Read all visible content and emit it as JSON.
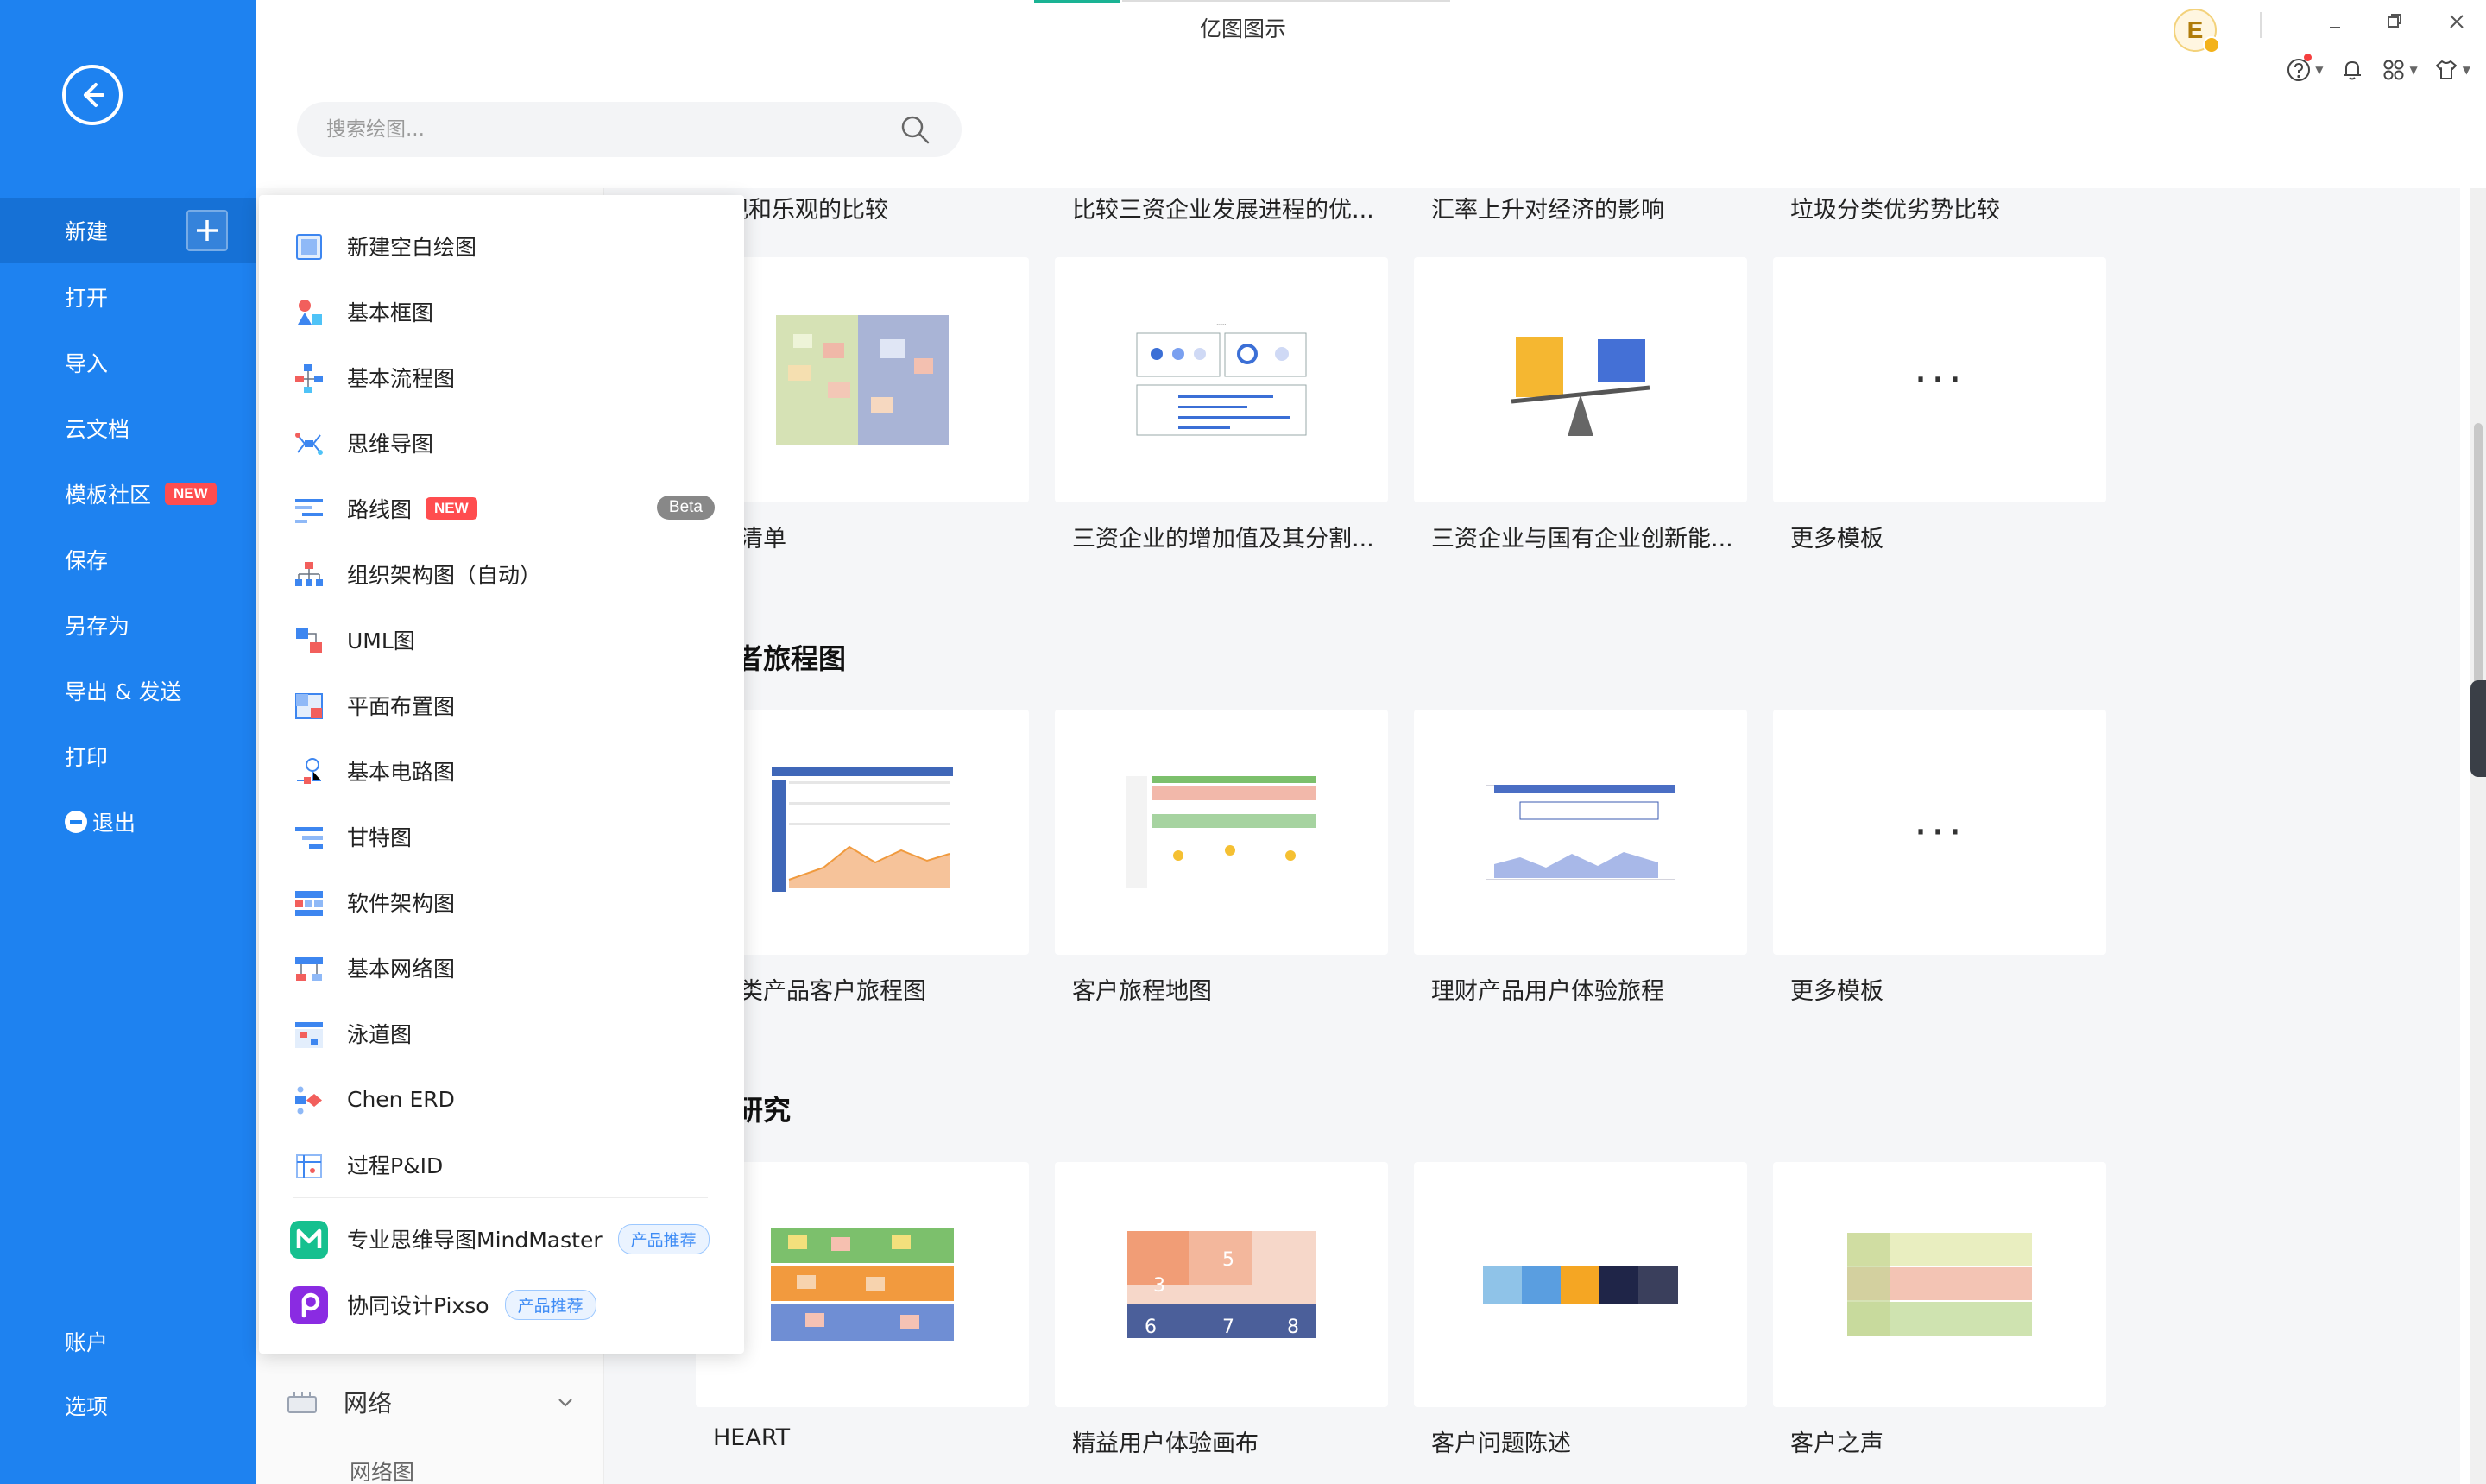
{
  "app": {
    "title": "亿图图示"
  },
  "sidebar": {
    "items": [
      {
        "label": "新建"
      },
      {
        "label": "打开"
      },
      {
        "label": "导入"
      },
      {
        "label": "云文档"
      },
      {
        "label": "模板社区",
        "badge": "NEW"
      },
      {
        "label": "保存"
      },
      {
        "label": "另存为"
      },
      {
        "label": "导出 & 发送"
      },
      {
        "label": "打印"
      },
      {
        "label": "退出"
      }
    ],
    "bottom": [
      {
        "label": "账户"
      },
      {
        "label": "选项"
      }
    ]
  },
  "header": {
    "avatar_letter": "E"
  },
  "search": {
    "placeholder": "搜索绘图..."
  },
  "new_menu": {
    "items": [
      {
        "label": "新建空白绘图",
        "icon": "blank-page-icon"
      },
      {
        "label": "基本框图",
        "icon": "basic-shapes-icon"
      },
      {
        "label": "基本流程图",
        "icon": "flowchart-icon"
      },
      {
        "label": "思维导图",
        "icon": "mindmap-icon"
      },
      {
        "label": "路线图",
        "icon": "roadmap-icon",
        "badge": "NEW",
        "badge_right": "Beta"
      },
      {
        "label": "组织架构图（自动）",
        "icon": "org-chart-icon"
      },
      {
        "label": "UML图",
        "icon": "uml-icon"
      },
      {
        "label": "平面布置图",
        "icon": "floor-plan-icon"
      },
      {
        "label": "基本电路图",
        "icon": "circuit-icon"
      },
      {
        "label": "甘特图",
        "icon": "gantt-icon"
      },
      {
        "label": "软件架构图",
        "icon": "software-arch-icon"
      },
      {
        "label": "基本网络图",
        "icon": "network-icon"
      },
      {
        "label": "泳道图",
        "icon": "swimlane-icon"
      },
      {
        "label": "Chen ERD",
        "icon": "erd-icon"
      },
      {
        "label": "过程P&ID",
        "icon": "pid-icon"
      }
    ],
    "promo": [
      {
        "label": "专业思维导图MindMaster",
        "badge": "产品推荐",
        "icon": "mindmaster-logo-icon",
        "color": "#16c08f"
      },
      {
        "label": "协同设计Pixso",
        "badge": "产品推荐",
        "icon": "pixso-logo-icon",
        "color": "#8a2be2"
      }
    ]
  },
  "category": {
    "network_label": "网络",
    "network_sub": "网络图"
  },
  "templates": {
    "row0_labels": [
      "观和乐观的比较",
      "比较三资企业发展进程的优...",
      "汇率上升对经济的影响",
      "垃圾分类优劣势比较"
    ],
    "row1_labels": [
      "晬清单",
      "三资企业的增加值及其分割...",
      "三资企业与国有企业创新能...",
      "更多模板"
    ],
    "section2_title": "费者旅程图",
    "row2_labels": [
      "育类产品客户旅程图",
      "客户旅程地图",
      "理财产品用户体验旅程",
      "更多模板"
    ],
    "section3_title": "户研究",
    "row3_labels": [
      "HEART",
      "精益用户体验画布",
      "客户问题陈述",
      "客户之声"
    ]
  }
}
